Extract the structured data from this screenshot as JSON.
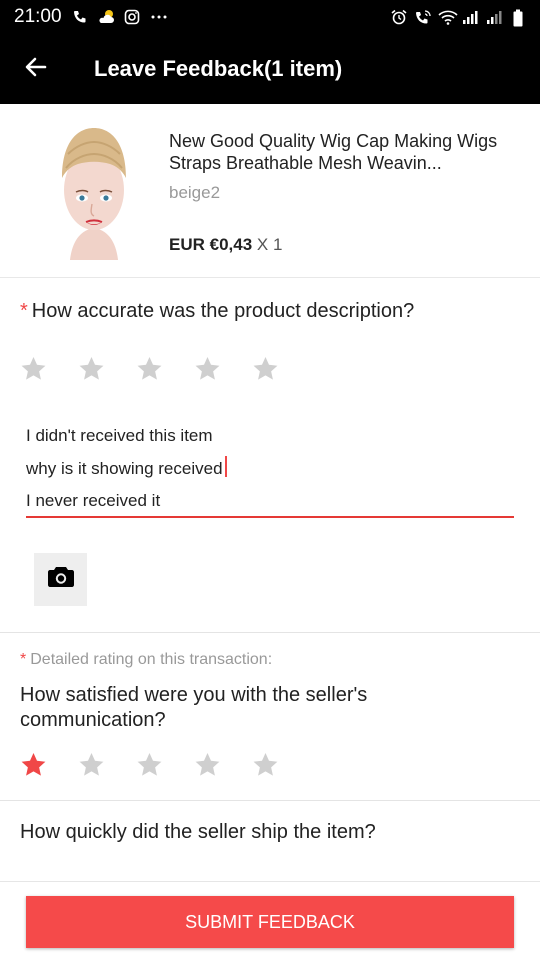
{
  "status_bar": {
    "time": "21:00",
    "left_icons": [
      "phone-icon",
      "weather-icon",
      "instagram-icon",
      "more-dots-icon"
    ],
    "right_icons": [
      "alarm-icon",
      "wifi-call-icon",
      "wifi-icon",
      "signal-icon",
      "signal-icon",
      "battery-icon"
    ]
  },
  "header": {
    "back_icon": "arrow-left-icon",
    "title": "Leave Feedback(1 item)"
  },
  "product": {
    "name": "New Good Quality Wig Cap Making Wigs Straps Breathable Mesh Weavin...",
    "variant": "beige2",
    "price": "EUR €0,43",
    "quantity": "X 1",
    "image_icon": "mannequin-wig-cap-image"
  },
  "description_rating": {
    "required_mark": "*",
    "question": "How accurate was the product description?",
    "rating": 0,
    "max": 5
  },
  "review": {
    "lines": [
      "I didn't received this item",
      "why is it showing received",
      "I never received it"
    ]
  },
  "photo": {
    "icon": "camera-icon"
  },
  "detailed": {
    "required_mark": "*",
    "label": "Detailed rating on this transaction:",
    "communication_question": "How satisfied were you with the seller's communication?",
    "communication_rating": 1,
    "shipping_question": "How quickly did the seller ship the item?"
  },
  "colors": {
    "accent": "#f54a4a",
    "star_active": "#f04747",
    "star_inactive": "#cfcfcf"
  },
  "actions": {
    "submit_label": "SUBMIT FEEDBACK"
  }
}
